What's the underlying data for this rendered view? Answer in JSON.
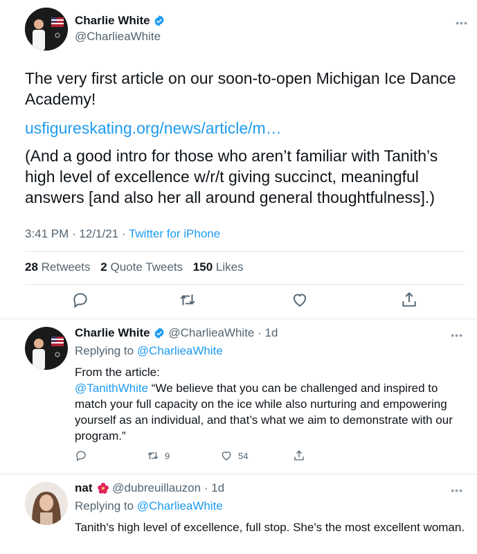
{
  "main_tweet": {
    "author_name": "Charlie White",
    "author_handle": "@CharlieaWhite",
    "text": "The very first article on our soon-to-open Michigan Ice Dance Academy!",
    "link": "usfigureskating.org/news/article/m…",
    "text2": "(And a good intro for those who aren’t familiar with Tanith’s high level of excellence w/r/t giving succinct, meaningful answers [and also her all around general thoughtfulness].)",
    "time": "3:41 PM · 12/1/21 · ",
    "source": "Twitter for iPhone",
    "retweets_count": "28",
    "retweets_label": "Retweets",
    "quotes_count": "2",
    "quotes_label": "Quote Tweets",
    "likes_count": "150",
    "likes_label": "Likes"
  },
  "reply1": {
    "author_name": "Charlie White",
    "author_handle": "@CharlieaWhite",
    "age": "· 1d",
    "replying_prefix": "Replying to ",
    "replying_to": "@CharlieaWhite",
    "line1": "From the article:",
    "mention": "@TanithWhite",
    "quote": " “We believe that you can be challenged and inspired to match your full capacity on the ice while also nurturing and empowering yourself as an individual, and that’s what we aim to demonstrate with our program.”",
    "retweets": "9",
    "likes": "54"
  },
  "reply2": {
    "author_name": "nat",
    "author_handle": "@dubreuillauzon",
    "age": "· 1d",
    "replying_prefix": "Replying to ",
    "replying_to": "@CharlieaWhite",
    "text": "Tanith's high level of excellence, full stop. She's the most excellent woman."
  },
  "icons": {
    "verified": "verified-badge-icon",
    "reply": "reply-icon",
    "retweet": "retweet-icon",
    "like": "heart-icon",
    "share": "share-icon",
    "more": "more-icon",
    "flower": "hibiscus-emoji"
  },
  "colors": {
    "accent": "#1d9bf0",
    "muted": "#536471",
    "text": "#0f1419"
  }
}
